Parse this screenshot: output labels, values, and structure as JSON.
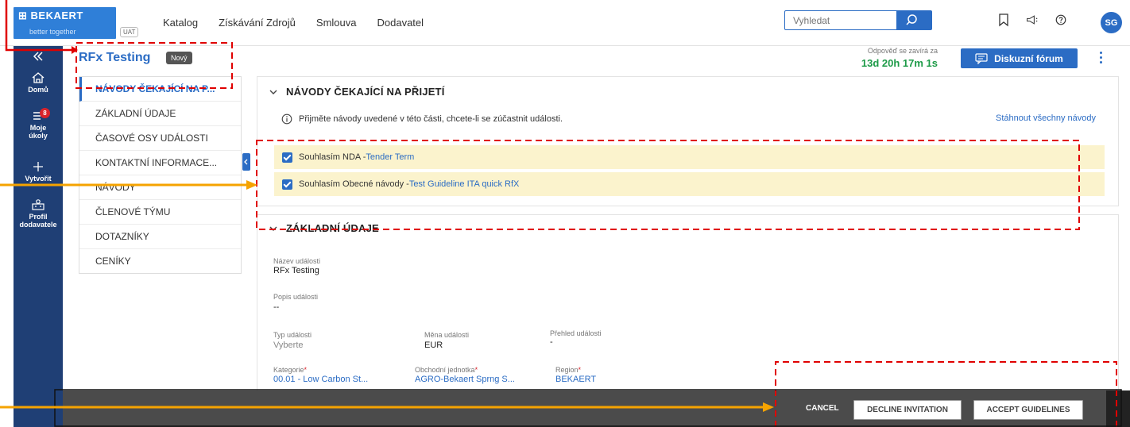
{
  "header": {
    "logo": {
      "brand": "⊞ BEKAERT",
      "tagline": "better together",
      "env": "UAT"
    },
    "nav": [
      "Katalog",
      "Získávání Zdrojů",
      "Smlouva",
      "Dodavatel"
    ],
    "search_placeholder": "Vyhledat",
    "avatar_initials": "SG"
  },
  "rail": {
    "items": [
      {
        "label_1": "Domů",
        "label_2": "",
        "icon": "home-icon"
      },
      {
        "label_1": "Moje",
        "label_2": "úkoly",
        "icon": "tasks-icon",
        "badge": "8"
      },
      {
        "label_1": "Vytvořit",
        "label_2": "",
        "icon": "plus-icon"
      },
      {
        "label_1": "Profil",
        "label_2": "dodavatele",
        "icon": "supplier-profile-icon"
      }
    ]
  },
  "event": {
    "title": "RFx Testing",
    "status": "Nový",
    "countdown_label": "Odpověď se zavírá za",
    "countdown_value": "13d 20h 17m 1s",
    "forum_button": "Diskuzní fórum"
  },
  "sections": [
    "NÁVODY ČEKAJÍCÍ NA P...",
    "ZÁKLADNÍ ÚDAJE",
    "ČASOVÉ OSY UDÁLOSTI",
    "KONTAKTNÍ INFORMACE...",
    "NÁVODY",
    "ČLENOVÉ TÝMU",
    "DOTAZNÍKY",
    "CENÍKY"
  ],
  "guidelines": {
    "heading": "NÁVODY ČEKAJÍCÍ NA PŘIJETÍ",
    "info": "Přijměte návody uvedené v této části, chcete-li se zúčastnit události.",
    "download_all": "Stáhnout všechny návody",
    "rows": [
      {
        "text": "Souhlasím NDA -",
        "link": "Tender Term",
        "checked": true
      },
      {
        "text": "Souhlasím Obecné návody -",
        "link": "Test Guideline ITA quick RfX",
        "checked": true
      }
    ]
  },
  "basic": {
    "heading": "ZÁKLADNÍ ÚDAJE",
    "event_name_label": "Název události",
    "event_name_value": "RFx Testing",
    "event_desc_label": "Popis události",
    "event_desc_value": "--",
    "event_type_label": "Typ události",
    "event_type_value": "Vyberte",
    "currency_label": "Měna události",
    "currency_value": "EUR",
    "overview_label": "Přehled události",
    "overview_value": "-",
    "category_label": "Kategorie",
    "category_value": "00.01 - Low Carbon St...",
    "business_unit_label": "Obchodní jednotka",
    "business_unit_value": "AGRO-Bekaert Sprng S...",
    "region_label": "Region",
    "region_value": "BEKAERT",
    "required_mark": "*"
  },
  "actions": {
    "cancel": "CANCEL",
    "decline": "DECLINE INVITATION",
    "accept": "ACCEPT GUIDELINES"
  },
  "colors": {
    "primary": "#2b6cc4",
    "rail": "#1f3f75",
    "highlight_row": "#fbf3cd",
    "countdown": "#1c9a47",
    "annotation_red": "#e00000",
    "annotation_orange": "#f5a300"
  }
}
